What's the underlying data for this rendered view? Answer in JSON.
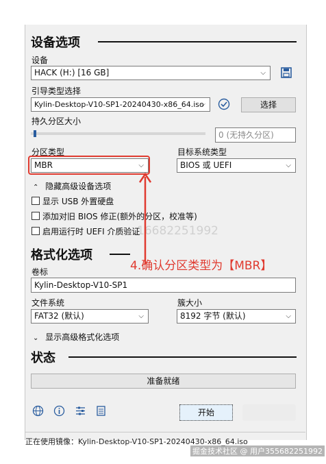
{
  "device_section": {
    "title": "设备选项",
    "device_label": "设备",
    "device_value": "HACK (H:) [16 GB]"
  },
  "boot": {
    "label": "引导类型选择",
    "value": "Kylin-Desktop-V10-SP1-20240430-x86_64.iso",
    "select_button": "选择"
  },
  "persist": {
    "label": "持久分区大小",
    "value": "0 (无持久分区)"
  },
  "partition": {
    "label": "分区类型",
    "value": "MBR"
  },
  "target": {
    "label": "目标系统类型",
    "value": "BIOS 或 UEFI"
  },
  "advanced_device": {
    "toggle": "隐藏高级设备选项",
    "options": [
      {
        "label": "显示 USB 外置硬盘",
        "checked": false
      },
      {
        "label": "添加对旧 BIOS 修正(额外的分区，校准等)",
        "checked": false
      },
      {
        "label": "启用运行时 UEFI 介质验证",
        "checked": false
      }
    ]
  },
  "format_section": {
    "title": "格式化选项",
    "volume_label": "卷标",
    "volume_value": "Kylin-Desktop-V10-SP1"
  },
  "filesystem": {
    "label": "文件系统",
    "value": "FAT32 (默认)"
  },
  "cluster": {
    "label": "簇大小",
    "value": "8192 字节 (默认)"
  },
  "advanced_format_toggle": "显示高级格式化选项",
  "status_section": {
    "title": "状态",
    "status_text": "准备就绪"
  },
  "start_button": "开始",
  "footer": {
    "text": "正在使用镜像：Kylin-Desktop-V10-SP1-20240430-x86_64.iso"
  },
  "annotation": {
    "text": "4.确认分区类型为【MBR】",
    "color": "#e03a2f"
  },
  "watermark": {
    "text": "16682251992",
    "credit": "掘金技术社区 @ 用户355682251992"
  },
  "icons": [
    "save-icon",
    "check-icon",
    "globe-icon",
    "info-icon",
    "settings-icon",
    "log-icon"
  ]
}
